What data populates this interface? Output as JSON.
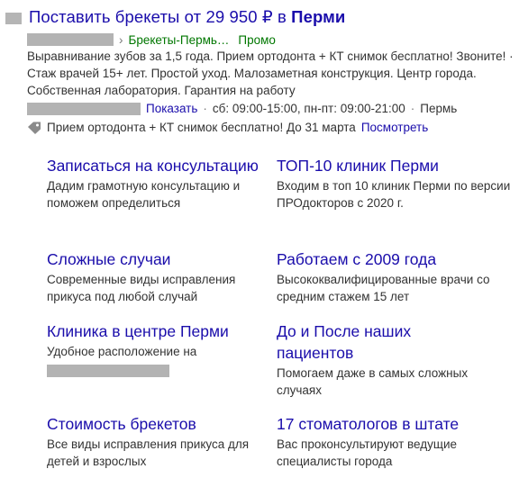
{
  "ad": {
    "title_prefix": "Поставить брекеты от 29 950 ₽ в ",
    "title_city": "Перми",
    "url_separator": "›",
    "url_path": "Брекеты-Пермь…",
    "promo_label": "Промо",
    "description": "Выравнивание зубов за 1,5 года. Прием ортодонта + КТ снимок бесплатно! Звоните! · Стаж врачей 15+ лет. Простой уход. Малозаметная конструкция. Центр города. Собственная лаборатория. Гарантия на работу",
    "show_phone_label": "Показать",
    "schedule": "сб: 09:00-15:00, пн-пт: 09:00-21:00",
    "location": "Пермь",
    "promo_text": "Прием ортодонта + КТ снимок бесплатно! До 31 марта",
    "promo_link": "Посмотреть",
    "colors": {
      "link": "#1a0dab",
      "url": "#007700",
      "text": "#333333",
      "redaction": "#b3b3b3"
    }
  },
  "sitelinks": [
    {
      "title": "Записаться на консультацию",
      "desc": "Дадим грамотную консультацию и поможем определиться"
    },
    {
      "title": "ТОП-10 клиник Перми",
      "desc": "Входим в топ 10 клиник Перми по версии ПРОдокторов с 2020 г."
    },
    {
      "title": "Сложные случаи",
      "desc": "Современные виды исправления прикуса под любой случай"
    },
    {
      "title": "Работаем с 2009 года",
      "desc": "Высококвалифицированные врачи со средним стажем 15 лет"
    },
    {
      "title": "Клиника в центре Перми",
      "desc": "Удобное расположение на"
    },
    {
      "title": "До и После наших пациентов",
      "desc": "Помогаем даже в самых сложных случаях"
    },
    {
      "title": "Стоимость брекетов",
      "desc": "Все виды исправления прикуса для детей и взрослых"
    },
    {
      "title": "17 стоматологов в штате",
      "desc": "Вас проконсультируют ведущие специалисты города"
    }
  ]
}
